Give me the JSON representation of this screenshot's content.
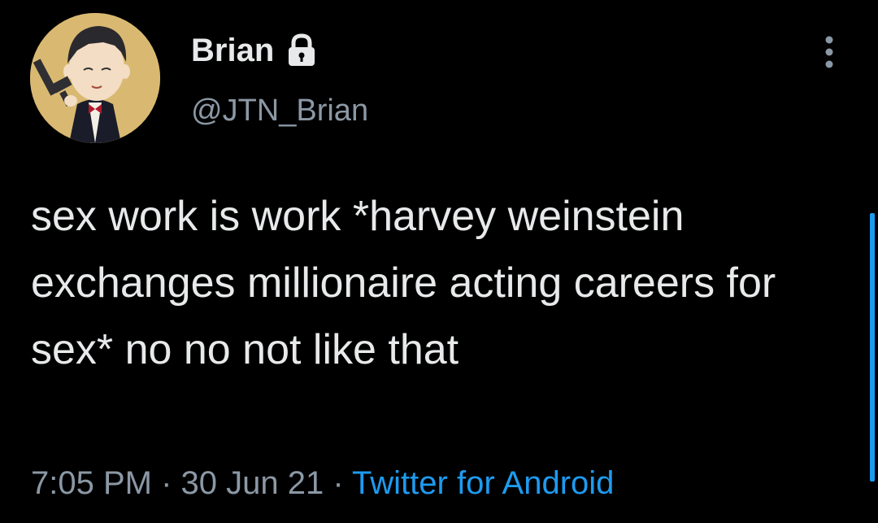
{
  "tweet": {
    "author": {
      "display_name": "Brian",
      "handle": "@JTN_Brian",
      "protected_icon": "lock-icon",
      "avatar_icon": "cartoon-character-avatar"
    },
    "text": "sex work is work *harvey weinstein exchanges millionaire acting careers for sex* no no not like that",
    "meta": {
      "time": "7:05 PM",
      "separator1": " · ",
      "date": "30 Jun 21",
      "separator2": " · ",
      "source": "Twitter for Android"
    },
    "menu_icon": "more-vertical-icon"
  },
  "colors": {
    "background": "#000000",
    "primary_text": "#e7e9ea",
    "secondary_text": "#8b98a5",
    "accent": "#1d9bf0",
    "avatar_bg": "#d9b971"
  }
}
